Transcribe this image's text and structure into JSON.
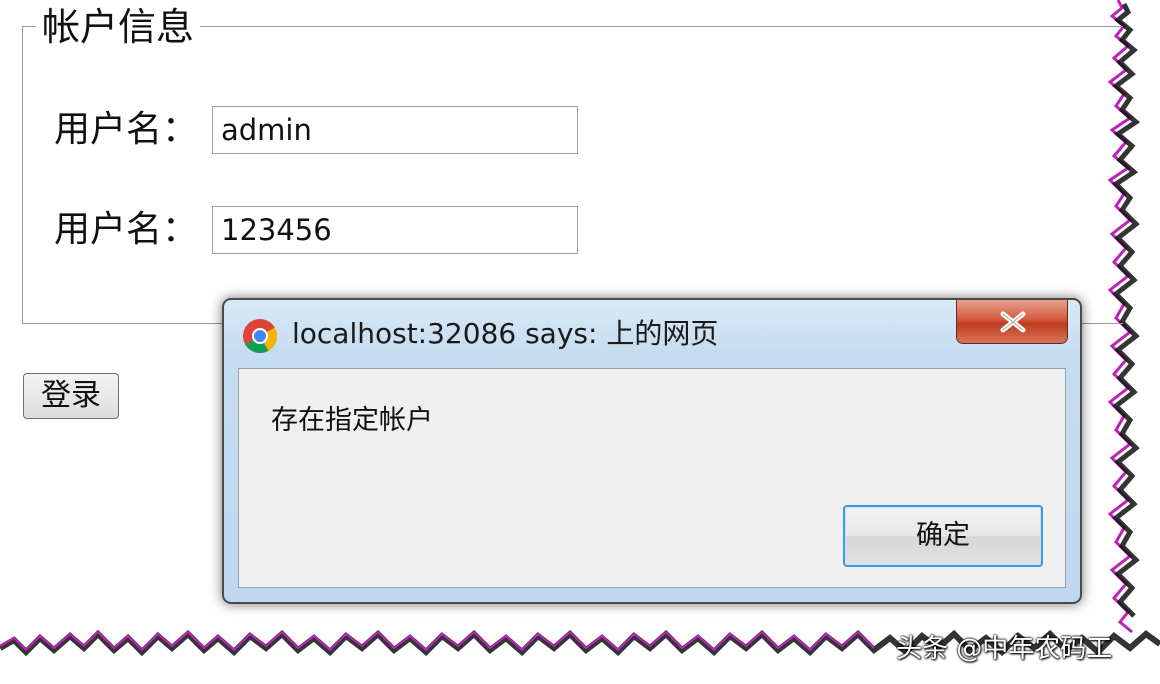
{
  "form": {
    "legend": "帐户信息",
    "rows": [
      {
        "label": "用户名：",
        "value": "admin"
      },
      {
        "label": "用户名：",
        "value": "123456"
      }
    ],
    "login_label": "登录"
  },
  "dialog": {
    "title": "localhost:32086 says: 上的网页",
    "close_symbol": "x",
    "message": "存在指定帐户",
    "ok_label": "确定"
  },
  "watermark": "头条 @中年农码工",
  "colors": {
    "dialog_frame": "#bfd8f0",
    "close_button": "#c0391f",
    "ok_border": "#3c9be0",
    "torn_edge": "#c020c0"
  }
}
